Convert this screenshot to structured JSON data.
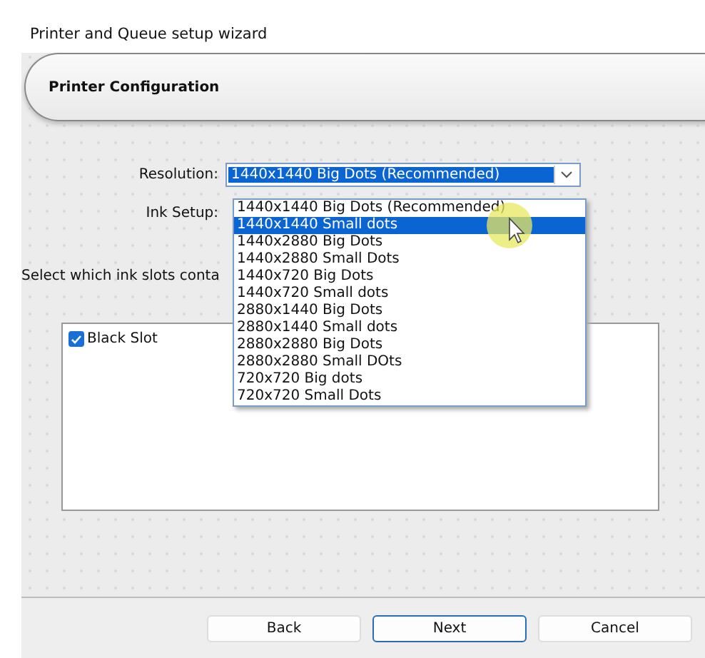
{
  "window": {
    "title": "Printer and Queue setup wizard"
  },
  "header": {
    "title": "Printer Configuration"
  },
  "resolution": {
    "label": "Resolution:",
    "value": "1440x1440 Big Dots (Recommended)",
    "expanded": true,
    "options": [
      {
        "label": "1440x1440 Big Dots (Recommended)",
        "highlighted": false
      },
      {
        "label": "1440x1440 Small dots",
        "highlighted": true
      },
      {
        "label": "1440x2880 Big Dots",
        "highlighted": false
      },
      {
        "label": "1440x2880 Small Dots",
        "highlighted": false
      },
      {
        "label": "1440x720 Big Dots",
        "highlighted": false
      },
      {
        "label": "1440x720 Small dots",
        "highlighted": false
      },
      {
        "label": "2880x1440 Big Dots",
        "highlighted": false
      },
      {
        "label": "2880x1440 Small dots",
        "highlighted": false
      },
      {
        "label": "2880x2880 Big Dots",
        "highlighted": false
      },
      {
        "label": "2880x2880 Small DOts",
        "highlighted": false
      },
      {
        "label": "720x720 Big dots",
        "highlighted": false
      },
      {
        "label": "720x720 Small Dots",
        "highlighted": false
      }
    ]
  },
  "ink_setup": {
    "label": "Ink Setup:"
  },
  "slots_prompt": "Select which ink slots conta",
  "slots": [
    {
      "label": "Black Slot",
      "checked": true
    }
  ],
  "buttons": [
    {
      "label": "Back",
      "selected": false
    },
    {
      "label": "Next",
      "selected": true
    },
    {
      "label": "Cancel",
      "selected": false
    }
  ]
}
